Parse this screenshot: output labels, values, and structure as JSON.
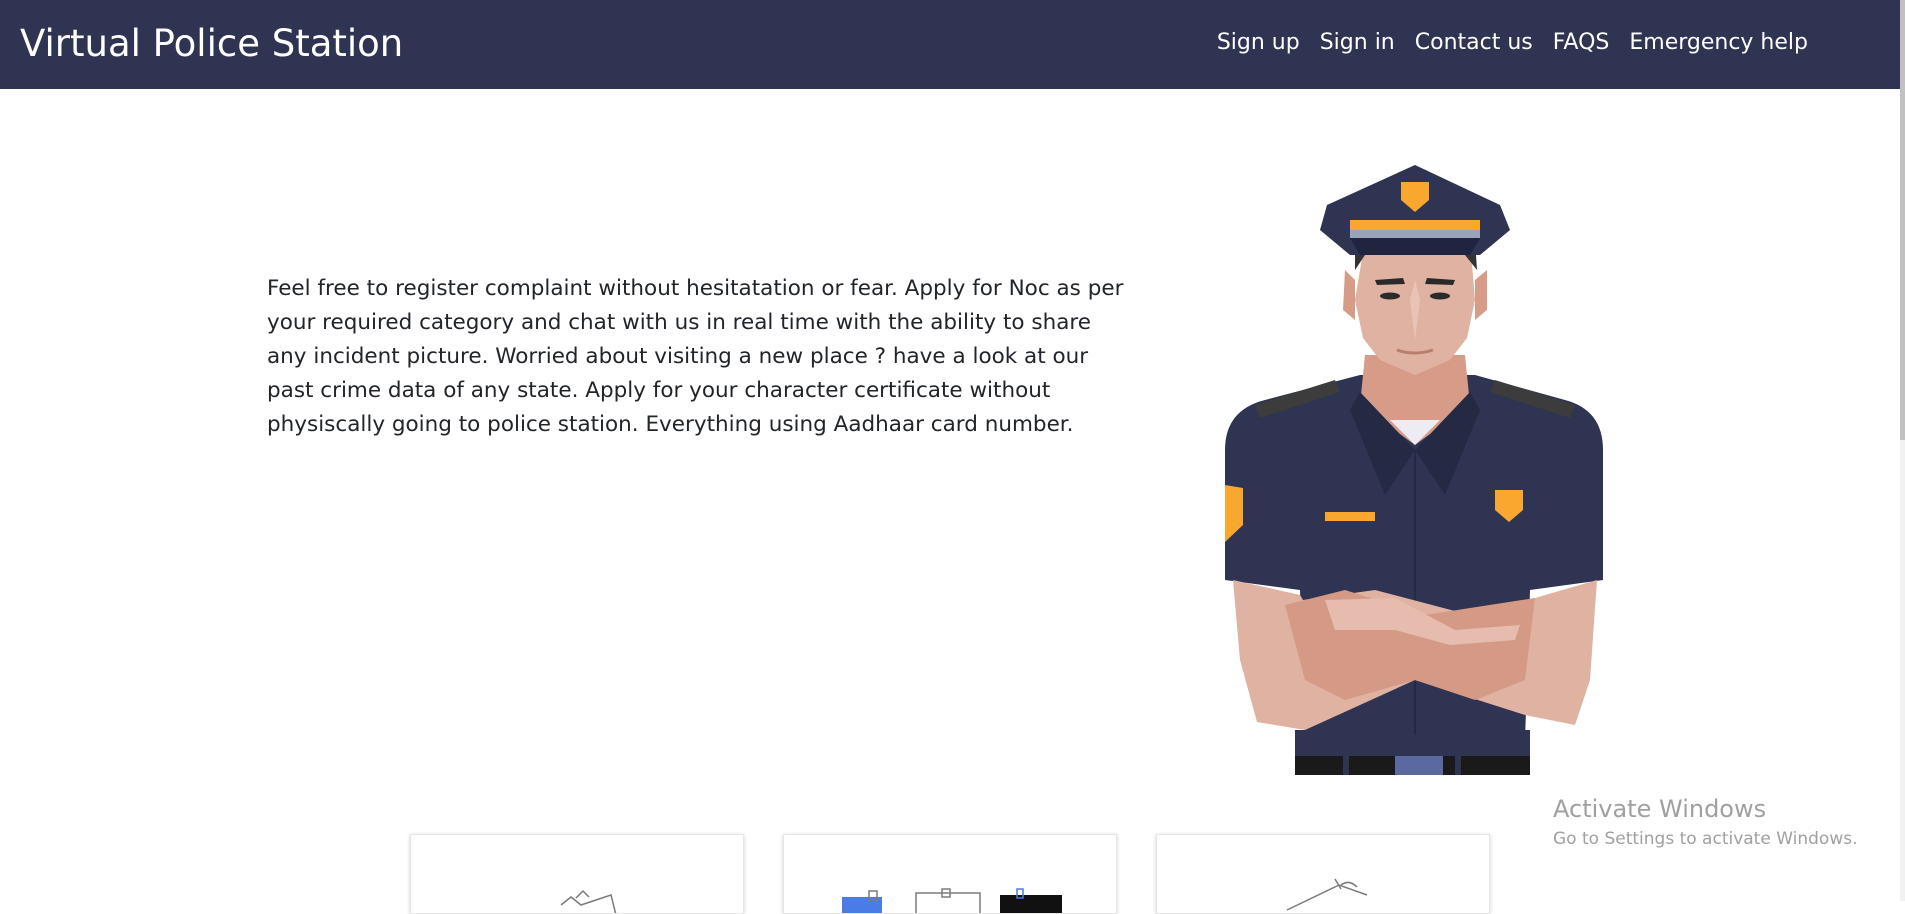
{
  "navbar": {
    "brand": "Virtual Police Station",
    "links": [
      {
        "label": "Sign up"
      },
      {
        "label": "Sign in"
      },
      {
        "label": "Contact us"
      },
      {
        "label": "FAQS"
      },
      {
        "label": "Emergency help"
      }
    ],
    "bg_color": "#2e3451"
  },
  "hero": {
    "description": "Feel free to register complaint without hesitatation or fear. Apply for Noc as per your required category and chat with us in real time with the ability to share any incident picture. Worried about visiting a new place ? have a look at our past crime data of any state. Apply for your character certificate without physiscally going to police station. Everything using Aadhaar card number.",
    "illustration": "police-officer-illustration"
  },
  "cards": [
    {
      "icon": "clipboard-icon"
    },
    {
      "icon": "documents-icon"
    },
    {
      "icon": "notebook-icon"
    }
  ],
  "watermark": {
    "title": "Activate Windows",
    "subtitle": "Go to Settings to activate Windows."
  }
}
